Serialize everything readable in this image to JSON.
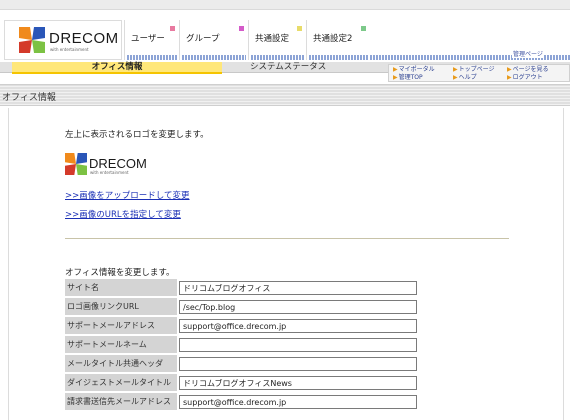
{
  "brand": {
    "name": "DRECOM",
    "tagline": "with entertainment"
  },
  "nav": {
    "tabs": [
      {
        "label": "ユーザー",
        "color": "#e87aa0"
      },
      {
        "label": "グループ",
        "color": "#d45bc9"
      },
      {
        "label": "共通設定",
        "color": "#e8dc6a"
      },
      {
        "label": "共通設定2",
        "color": "#7dc98a"
      }
    ],
    "admin_label": "管理ページ"
  },
  "subnav": {
    "active": "オフィス情報",
    "other": "システムステータス"
  },
  "quick_links": [
    "マイポータル",
    "トップページ",
    "ページを見る",
    "管理TOP",
    "ヘルプ",
    "ログアウト"
  ],
  "page": {
    "title": "オフィス情報"
  },
  "logo_section": {
    "description": "左上に表示されるロゴを変更します。",
    "upload_link": ">>画像をアップロードして変更",
    "url_link": ">>画像のURLを指定して変更"
  },
  "office_form": {
    "description": "オフィス情報を変更します。",
    "fields": [
      {
        "label": "サイト名",
        "value": "ドリコムブログオフィス"
      },
      {
        "label": "ロゴ画像リンクURL",
        "value": "/sec/Top.blog"
      },
      {
        "label": "サポートメールアドレス",
        "value": "support@office.drecom.jp"
      },
      {
        "label": "サポートメールネーム",
        "value": ""
      },
      {
        "label": "メールタイトル共通ヘッダ",
        "value": ""
      },
      {
        "label": "ダイジェストメールタイトル",
        "value": "ドリコムブログオフィスNews"
      },
      {
        "label": "請求書送信先メールアドレス",
        "value": "support@office.drecom.jp"
      }
    ]
  },
  "colors": {
    "active_tab": "#ffe77a",
    "link": "#1a2fb5",
    "label_bg": "#d4d4d4",
    "logo_orange": "#f08a1c",
    "logo_blue": "#2a56b8",
    "logo_red": "#d43a2a",
    "logo_green": "#7cc243"
  }
}
